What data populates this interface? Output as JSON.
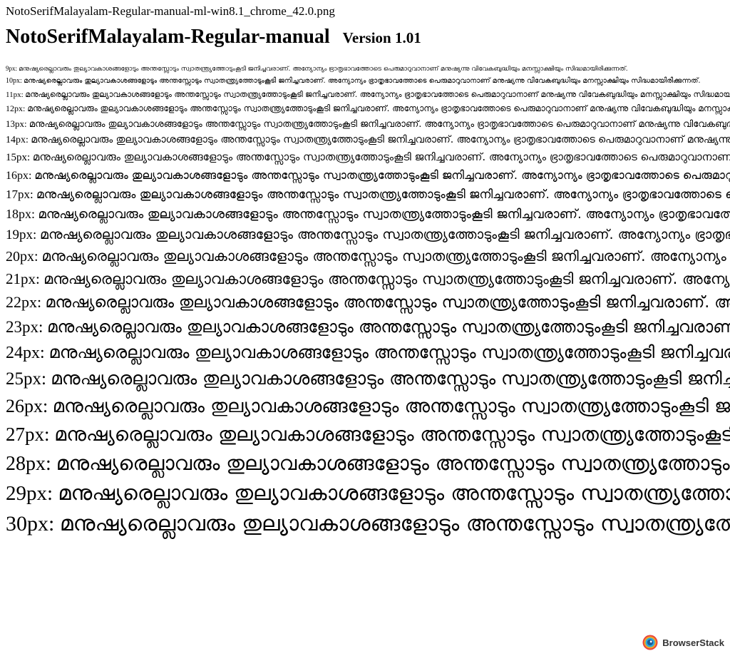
{
  "header": {
    "filename": "NotoSerifMalayalam-Regular-manual-ml-win8.1_chrome_42.0.png",
    "font_name": "NotoSerifMalayalam-Regular-manual",
    "version": "Version 1.01"
  },
  "sample_text": "മനുഷ്യരെല്ലാവരും തുല്യാവകാശങ്ങളോടും അന്തസ്സോടും സ്വാതന്ത്ര്യത്തോടുംകൂടി ജനിച്ചവരാണ്. അന്യോന്യം ഭ്രാതൃഭാവത്തോടെ പെരുമാറുവാനാണ് മനുഷ്യന്നു വിവേകബുദ്ധിയും മനസ്സാക്ഷിയും സിദ്ധമായിരിക്കുന്നത്.",
  "rows": [
    {
      "label": "9px:",
      "size": 9
    },
    {
      "label": "10px:",
      "size": 10
    },
    {
      "label": "11px:",
      "size": 11
    },
    {
      "label": "12px:",
      "size": 12
    },
    {
      "label": "13px:",
      "size": 13
    },
    {
      "label": "14px:",
      "size": 14
    },
    {
      "label": "15px:",
      "size": 15
    },
    {
      "label": "16px:",
      "size": 16
    },
    {
      "label": "17px:",
      "size": 17
    },
    {
      "label": "18px:",
      "size": 18
    },
    {
      "label": "19px:",
      "size": 19
    },
    {
      "label": "20px:",
      "size": 20
    },
    {
      "label": "21px:",
      "size": 21
    },
    {
      "label": "22px:",
      "size": 22
    },
    {
      "label": "23px:",
      "size": 23
    },
    {
      "label": "24px:",
      "size": 24
    },
    {
      "label": "25px:",
      "size": 25
    },
    {
      "label": "26px:",
      "size": 26
    },
    {
      "label": "27px:",
      "size": 27
    },
    {
      "label": "28px:",
      "size": 28
    },
    {
      "label": "29px:",
      "size": 29
    },
    {
      "label": "30px:",
      "size": 30
    }
  ],
  "watermark": {
    "label": "BrowserStack",
    "icon": "browserstack-logo-icon"
  },
  "colors": {
    "text": "#000000",
    "background": "#ffffff"
  }
}
